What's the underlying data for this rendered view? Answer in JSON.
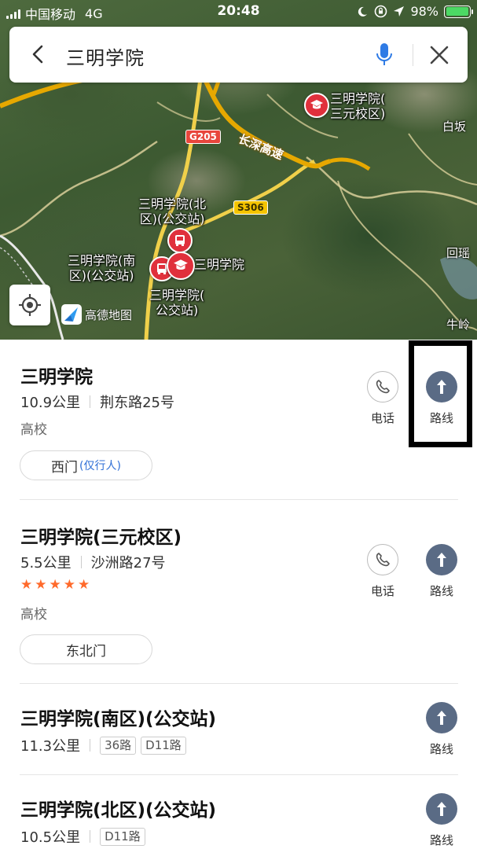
{
  "status_bar": {
    "carrier": "中国移动",
    "network": "4G",
    "time": "20:48",
    "battery_percent": "98%",
    "battery_level": 0.98,
    "battery_color": "#4cd964"
  },
  "search": {
    "query": "三明学院",
    "back_icon": "chevron-left-icon",
    "voice_icon": "microphone-icon",
    "close_icon": "close-icon",
    "accent_color": "#2f7be5"
  },
  "map": {
    "poi_labels": [
      {
        "line1": "三明学院(",
        "line2": "三元校区)"
      },
      {
        "line1": "三明学院(北",
        "line2": "区)(公交站)"
      },
      {
        "line1": "三明学院(南",
        "line2": "区)(公交站)"
      },
      {
        "line1": "三明学院",
        "line2": ""
      },
      {
        "line1": "三明学院(",
        "line2": "公交站)"
      }
    ],
    "place_labels": [
      "白坂",
      "回瑶",
      "牛岭"
    ],
    "road_shields": [
      "G205",
      "S306"
    ],
    "road_name": "长深高速",
    "logo_text": "高德地图",
    "pin_color": "#e0303c"
  },
  "results": [
    {
      "title": "三明学院",
      "distance": "10.9公里",
      "address": "荆东路25号",
      "category": "高校",
      "gate": "西门",
      "gate_note": "(仅行人)",
      "phone_label": "电话",
      "route_label": "路线"
    },
    {
      "title": "三明学院(三元校区)",
      "distance": "5.5公里",
      "address": "沙洲路27号",
      "rating": 5,
      "category": "高校",
      "gate": "东北门",
      "phone_label": "电话",
      "route_label": "路线"
    },
    {
      "title": "三明学院(南区)(公交站)",
      "distance": "11.3公里",
      "lines": [
        "36路",
        "D11路"
      ],
      "route_label": "路线"
    },
    {
      "title": "三明学院(北区)(公交站)",
      "distance": "10.5公里",
      "lines": [
        "D11路"
      ],
      "route_label": "路线"
    }
  ],
  "colors": {
    "star": "#ff6a2b",
    "route_button": "#5a6b85",
    "gate_note": "#2f6fd6"
  }
}
